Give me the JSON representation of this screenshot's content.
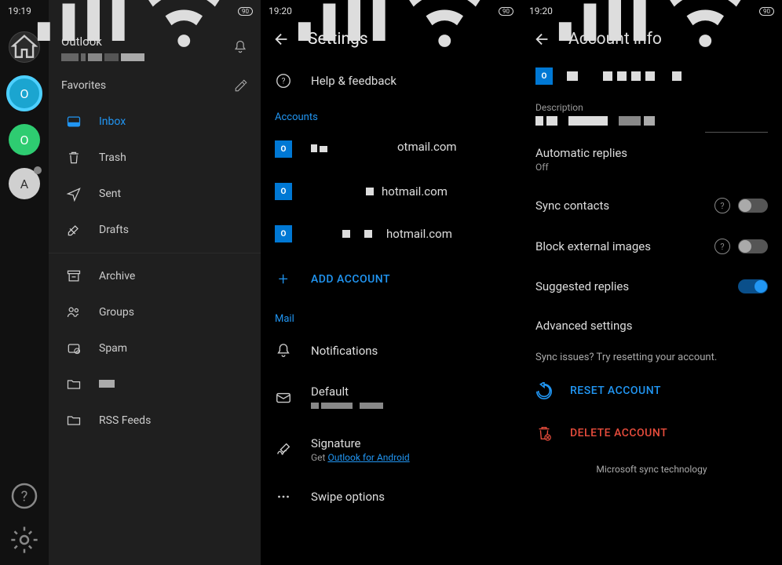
{
  "pane1": {
    "status_time": "19:19",
    "battery": "90",
    "app_title": "Outlook",
    "favorites_label": "Favorites",
    "rail": {
      "o1": "O",
      "o2": "O",
      "a": "A"
    },
    "folders": {
      "inbox": "Inbox",
      "trash": "Trash",
      "sent": "Sent",
      "drafts": "Drafts",
      "archive": "Archive",
      "groups": "Groups",
      "spam": "Spam",
      "rss": "RSS Feeds"
    }
  },
  "pane2": {
    "status_time": "19:20",
    "battery": "90",
    "title": "Settings",
    "help": "Help & feedback",
    "accounts_label": "Accounts",
    "accounts": [
      {
        "email": "otmail.com"
      },
      {
        "email": "hotmail.com"
      },
      {
        "email": "hotmail.com"
      }
    ],
    "add_account": "ADD ACCOUNT",
    "mail_label": "Mail",
    "notifications": "Notifications",
    "default": "Default",
    "signature": "Signature",
    "signature_sub_pre": "Get ",
    "signature_sub_link": "Outlook for Android",
    "swipe": "Swipe options"
  },
  "pane3": {
    "status_time": "19:20",
    "battery": "90",
    "title": "Account info",
    "description_label": "Description",
    "auto_replies": "Automatic replies",
    "auto_replies_value": "Off",
    "sync_contacts": "Sync contacts",
    "block_images": "Block external images",
    "suggested_replies": "Suggested replies",
    "advanced": "Advanced settings",
    "sync_issues": "Sync issues? Try resetting your account.",
    "reset": "RESET ACCOUNT",
    "delete": "DELETE ACCOUNT",
    "footer": "Microsoft sync technology"
  }
}
